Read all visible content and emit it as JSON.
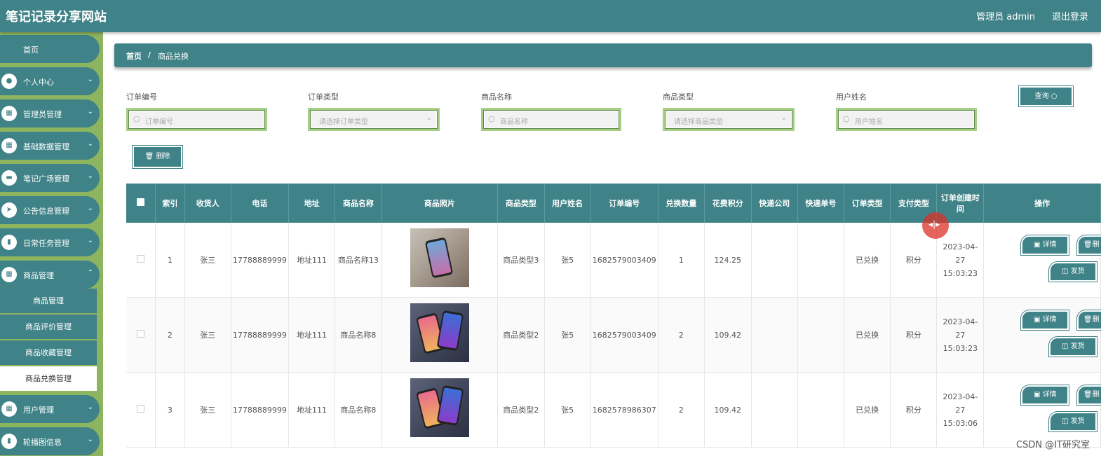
{
  "header": {
    "site_title": "笔记记录分享网站",
    "admin_label": "管理员 admin",
    "logout_label": "退出登录"
  },
  "sidebar": {
    "home": "首页",
    "items": [
      {
        "label": "个人中心",
        "icon": "user-icon"
      },
      {
        "label": "管理员管理",
        "icon": "grid-icon"
      },
      {
        "label": "基础数据管理",
        "icon": "grid-icon"
      },
      {
        "label": "笔记广场管理",
        "icon": "monitor-icon"
      },
      {
        "label": "公告信息管理",
        "icon": "send-icon"
      },
      {
        "label": "日常任务管理",
        "icon": "chart-icon"
      },
      {
        "label": "商品管理",
        "icon": "grid-icon"
      }
    ],
    "sub_items": [
      "商品管理",
      "商品评价管理",
      "商品收藏管理",
      "商品兑换管理"
    ],
    "bottom_items": [
      {
        "label": "用户管理",
        "icon": "grid-icon"
      },
      {
        "label": "轮播图信息",
        "icon": "chart-icon"
      }
    ]
  },
  "breadcrumb": {
    "home": "首页",
    "separator": "/",
    "current": "商品兑换"
  },
  "filters": {
    "order_no": {
      "label": "订单编号",
      "placeholder": "订单编号"
    },
    "order_type": {
      "label": "订单类型",
      "placeholder": "请选择订单类型"
    },
    "goods_name": {
      "label": "商品名称",
      "placeholder": "商品名称"
    },
    "goods_type": {
      "label": "商品类型",
      "placeholder": "请选择商品类型"
    },
    "user_name": {
      "label": "用户姓名",
      "placeholder": "用户姓名"
    },
    "query_label": "查询",
    "delete_label": "删除"
  },
  "table": {
    "headers": [
      "索引",
      "收货人",
      "电话",
      "地址",
      "商品名称",
      "商品照片",
      "商品类型",
      "用户姓名",
      "订单编号",
      "兑换数量",
      "花费积分",
      "快递公司",
      "快递单号",
      "订单类型",
      "支付类型",
      "订单创建时间",
      "操作"
    ],
    "rows": [
      {
        "index": "1",
        "receiver": "张三",
        "phone": "17788889999",
        "address": "地址111",
        "goods_name": "商品名称13",
        "goods_type": "商品类型3",
        "user_name": "张5",
        "order_no": "1682579003409",
        "quantity": "1",
        "points": "124.25",
        "courier": "",
        "tracking": "",
        "order_type": "已兑换",
        "pay_type": "积分",
        "created": "2023-04-27 15:03:23"
      },
      {
        "index": "2",
        "receiver": "张三",
        "phone": "17788889999",
        "address": "地址111",
        "goods_name": "商品名称8",
        "goods_type": "商品类型2",
        "user_name": "张5",
        "order_no": "1682579003409",
        "quantity": "2",
        "points": "109.42",
        "courier": "",
        "tracking": "",
        "order_type": "已兑换",
        "pay_type": "积分",
        "created": "2023-04-27 15:03:23"
      },
      {
        "index": "3",
        "receiver": "张三",
        "phone": "17788889999",
        "address": "地址111",
        "goods_name": "商品名称8",
        "goods_type": "商品类型2",
        "user_name": "张5",
        "order_no": "1682578986307",
        "quantity": "2",
        "points": "109.42",
        "courier": "",
        "tracking": "",
        "order_type": "已兑换",
        "pay_type": "积分",
        "created": "2023-04-27 15:03:06"
      }
    ],
    "action_detail": "详情",
    "action_delete": "删",
    "action_ship": "发货"
  },
  "watermark": "CSDN @IT研究室",
  "colors": {
    "primary": "#3f8287",
    "sidebar_bg": "#8db55f",
    "input_border": "#a6cf85"
  }
}
